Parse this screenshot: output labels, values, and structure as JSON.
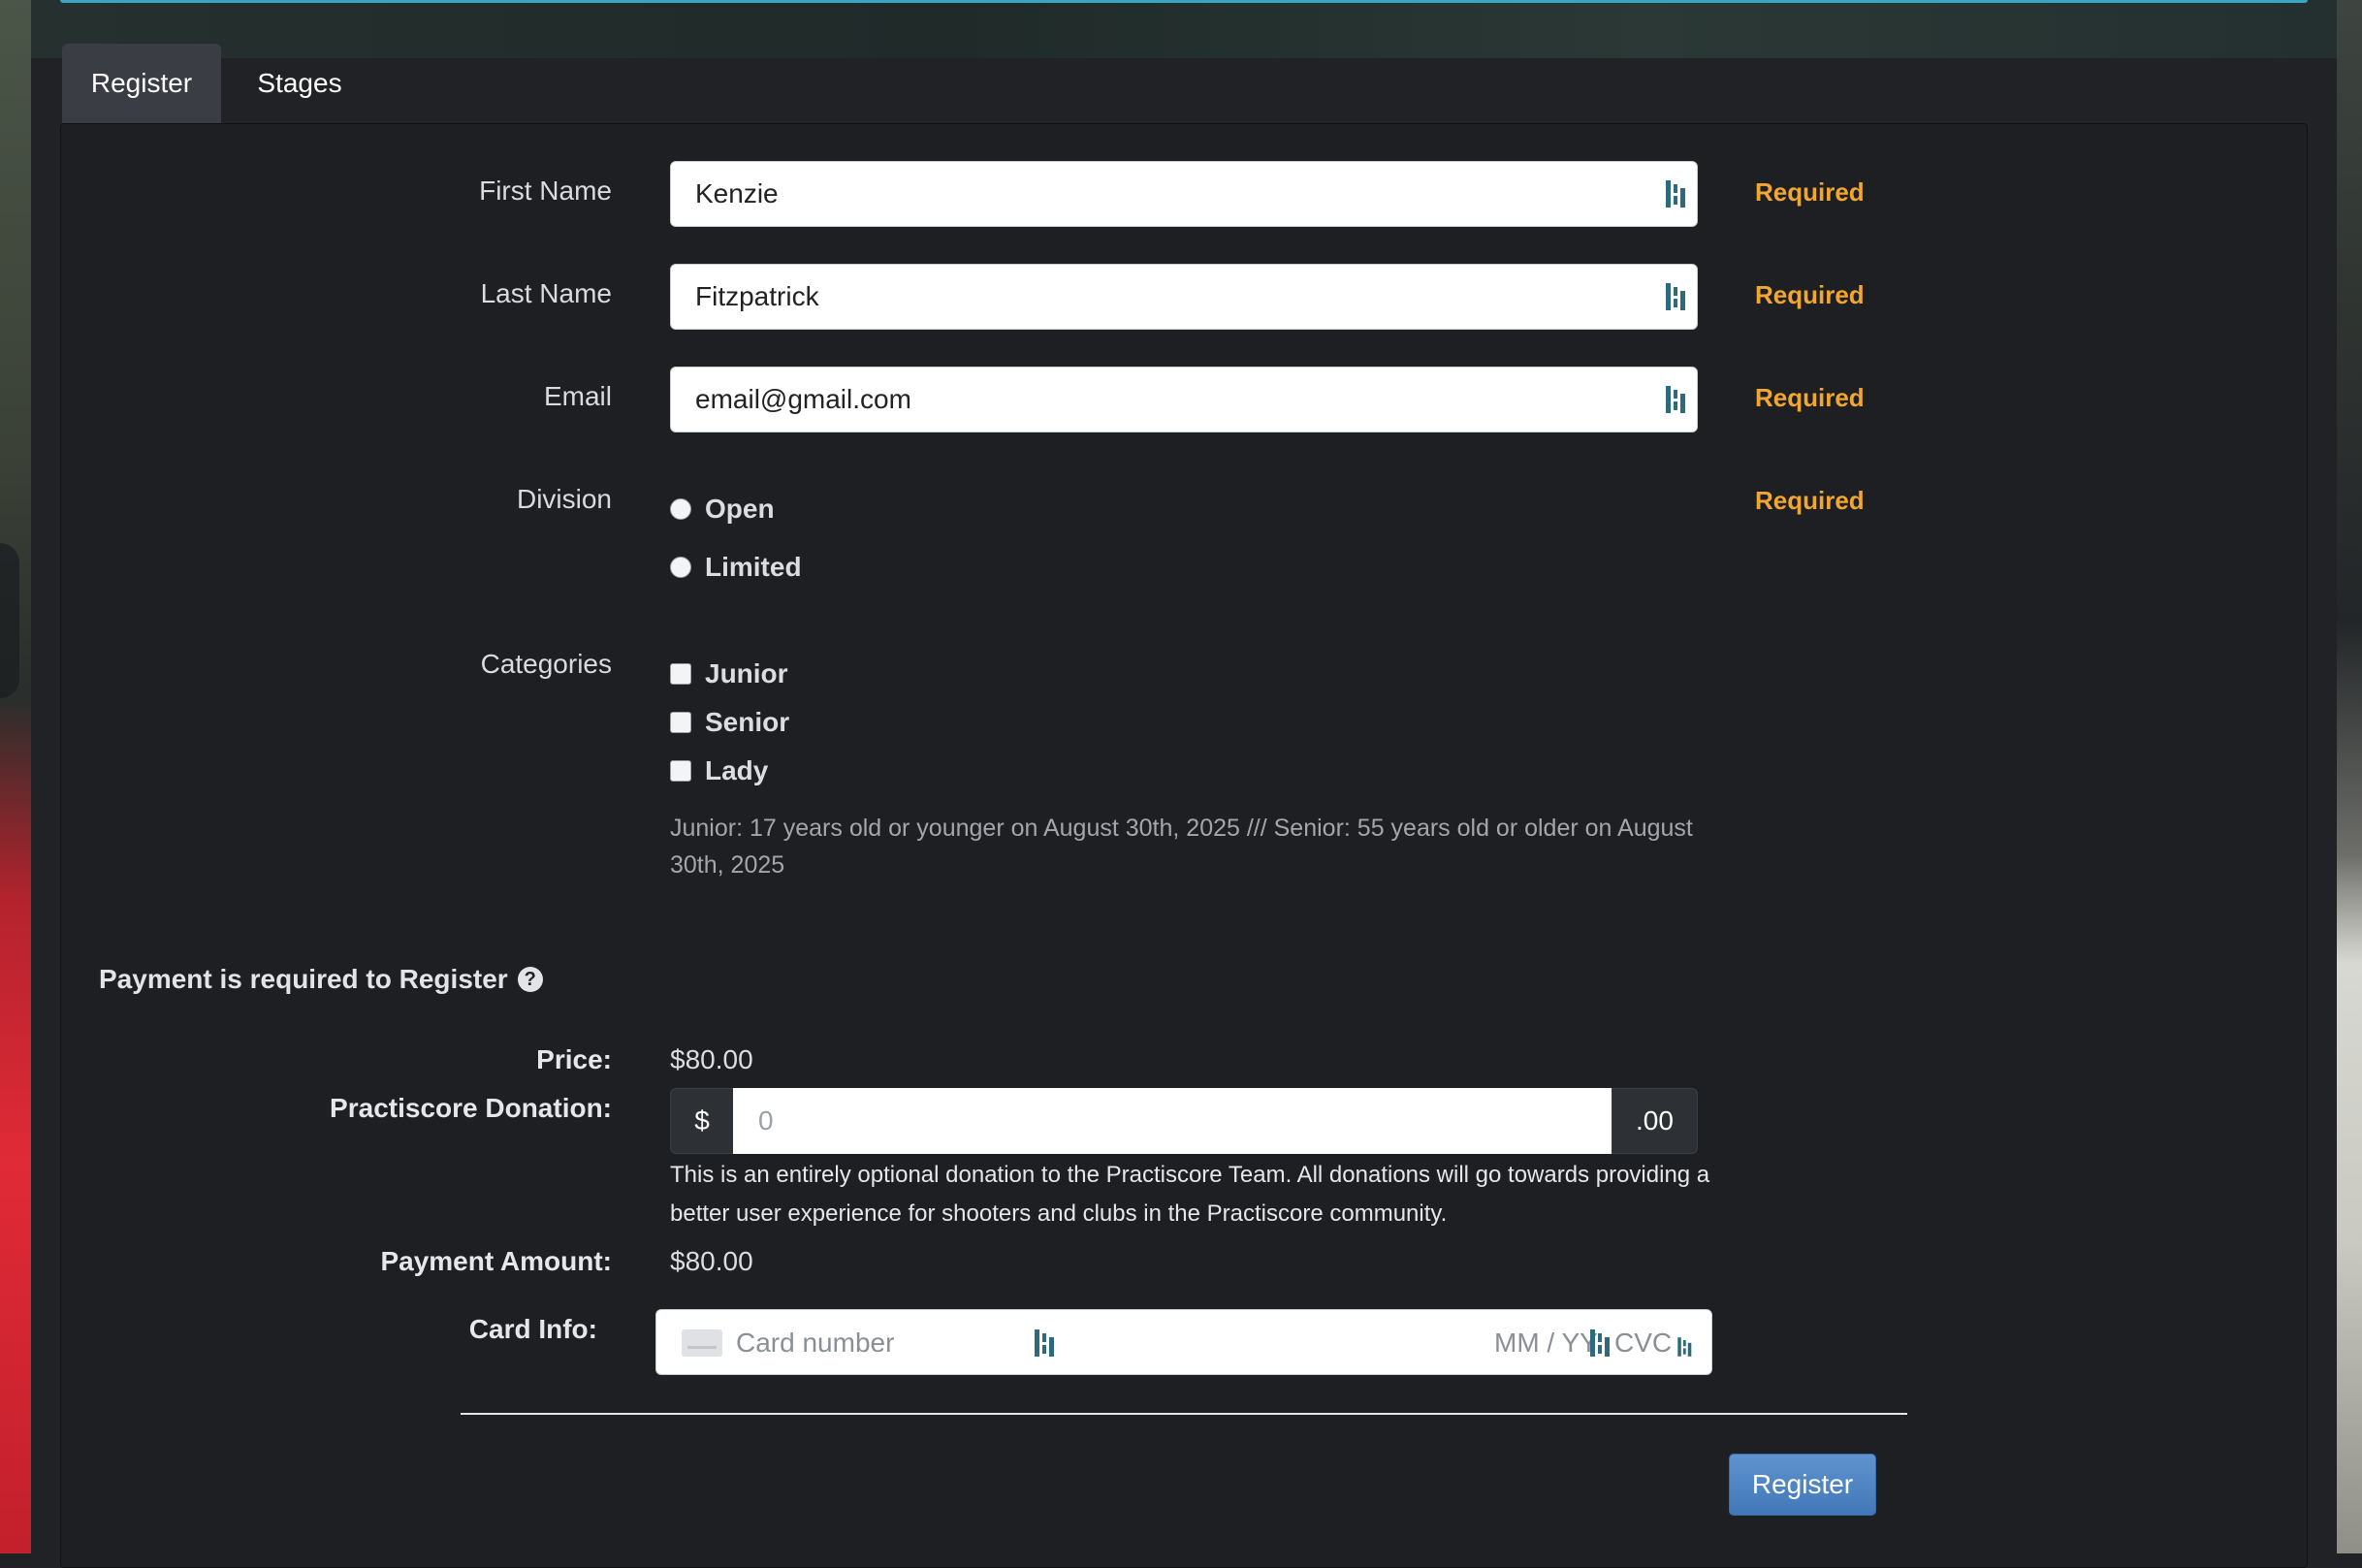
{
  "tabs": [
    {
      "label": "Register",
      "active": true
    },
    {
      "label": "Stages",
      "active": false
    }
  ],
  "form": {
    "first_name": {
      "label": "First Name",
      "value": "Kenzie",
      "required": "Required"
    },
    "last_name": {
      "label": "Last Name",
      "value": "Fitzpatrick",
      "required": "Required"
    },
    "email": {
      "label": "Email",
      "value": "email@gmail.com",
      "required": "Required"
    },
    "division": {
      "label": "Division",
      "required": "Required",
      "options": [
        "Open",
        "Limited"
      ]
    },
    "categories": {
      "label": "Categories",
      "options": [
        "Junior",
        "Senior",
        "Lady"
      ],
      "help": "Junior: 17 years old or younger on August 30th, 2025 /// Senior: 55 years old or older on August 30th, 2025"
    }
  },
  "payment": {
    "title": "Payment is required to Register",
    "help_icon": "question-circle-icon",
    "price_label": "Price:",
    "price_value": "$80.00",
    "donation_label": "Practiscore Donation:",
    "donation_prefix": "$",
    "donation_placeholder": "0",
    "donation_suffix": ".00",
    "donation_note": "This is an entirely optional donation to the Practiscore Team. All donations will go towards providing a better user experience for shooters and clubs in the Practiscore community.",
    "amount_label": "Payment Amount:",
    "amount_value": "$80.00",
    "card_label": "Card Info:",
    "card_number_placeholder": "Card number",
    "card_expiry_placeholder": "MM / YY",
    "card_cvc_placeholder": "CVC"
  },
  "actions": {
    "register_label": "Register"
  },
  "colors": {
    "accent": "#3aa6c2",
    "required": "#f0a631",
    "button": "#4f85c4",
    "panel": "#1e1f23"
  }
}
